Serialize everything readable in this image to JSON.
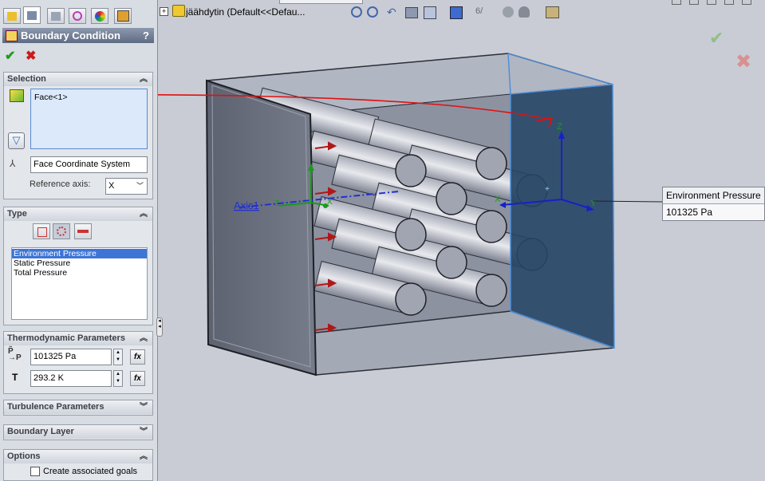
{
  "tree_label": "jäähdytin  (Default<<Defau...",
  "property_manager": {
    "title": "Boundary Condition",
    "help_label": "?",
    "ok_glyph": "✔",
    "cancel_glyph": "✖"
  },
  "selection": {
    "header": "Selection",
    "face_item": "Face<1>",
    "coordinate_system": "Face Coordinate System",
    "reference_axis_label": "Reference axis:",
    "reference_axis_value": "X"
  },
  "type_group": {
    "header": "Type",
    "options": [
      "Environment Pressure",
      "Static Pressure",
      "Total Pressure"
    ],
    "selected_index": 0
  },
  "thermo": {
    "header": "Thermodynamic Parameters",
    "pressure_value": "101325 Pa",
    "temperature_label": "T",
    "temperature_value": "293.2 K",
    "fx_label": "fx"
  },
  "turbulence": {
    "header": "Turbulence Parameters"
  },
  "boundary_layer": {
    "header": "Boundary Layer"
  },
  "options": {
    "header": "Options",
    "create_goals_label": "Create associated goals",
    "create_goals_checked": false
  },
  "tooltip": {
    "title": "Environment Pressure",
    "value": "101325 Pa"
  },
  "axis_label": "Axis1",
  "triad_labels": {
    "z": "Z",
    "x": "X",
    "y": "Y"
  },
  "colors": {
    "accent": "#3d74d6",
    "model_face": "#6b7181",
    "selected_face": "#274566",
    "annotation_red": "#e01010"
  }
}
